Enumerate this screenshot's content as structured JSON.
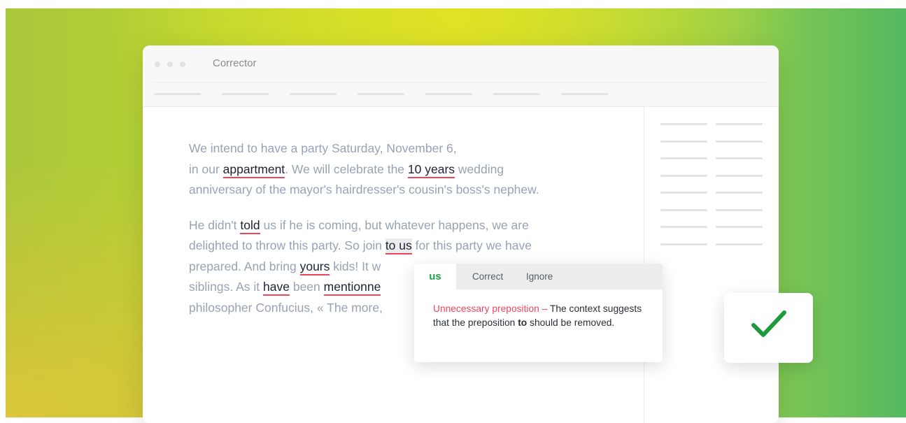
{
  "window": {
    "title": "Corrector"
  },
  "editor": {
    "p1": {
      "t1": "We intend to have a party Saturday, November 6,",
      "t2": "in our ",
      "e1": "appartment",
      "t3": ".  We will celebrate the ",
      "e2": "10 years",
      "t4": " wedding",
      "t5": "anniversary of the mayor's hairdresser's cousin's boss's nephew."
    },
    "p2": {
      "t1": "He didn't ",
      "e1": "told",
      "t2": " us if he is coming, but whatever happens, we are",
      "t3": "delighted to throw this party. So join ",
      "e2": "to us",
      "t4": " for this party we have",
      "t5": "prepared. And bring ",
      "e3": "yours",
      "t6": " kids! It w",
      "t7": "siblings. As it ",
      "e4": "have",
      "t8": " been ",
      "e5": "mentionne",
      "t9": "philosopher Confucius, « The more,"
    }
  },
  "popup": {
    "suggestion": "us",
    "correct_label": "Correct",
    "ignore_label": "Ignore",
    "error_type": "Unnecessary preposition",
    "dash": " – ",
    "message_part1": "The context suggests that the preposition ",
    "message_bold": "to",
    "message_part2": " should be removed."
  },
  "colors": {
    "error_underline": "#f0455d",
    "suggestion_green": "#1ea24a",
    "check_green": "#1e9a3c"
  },
  "icons": {
    "check": "checkmark-icon"
  }
}
